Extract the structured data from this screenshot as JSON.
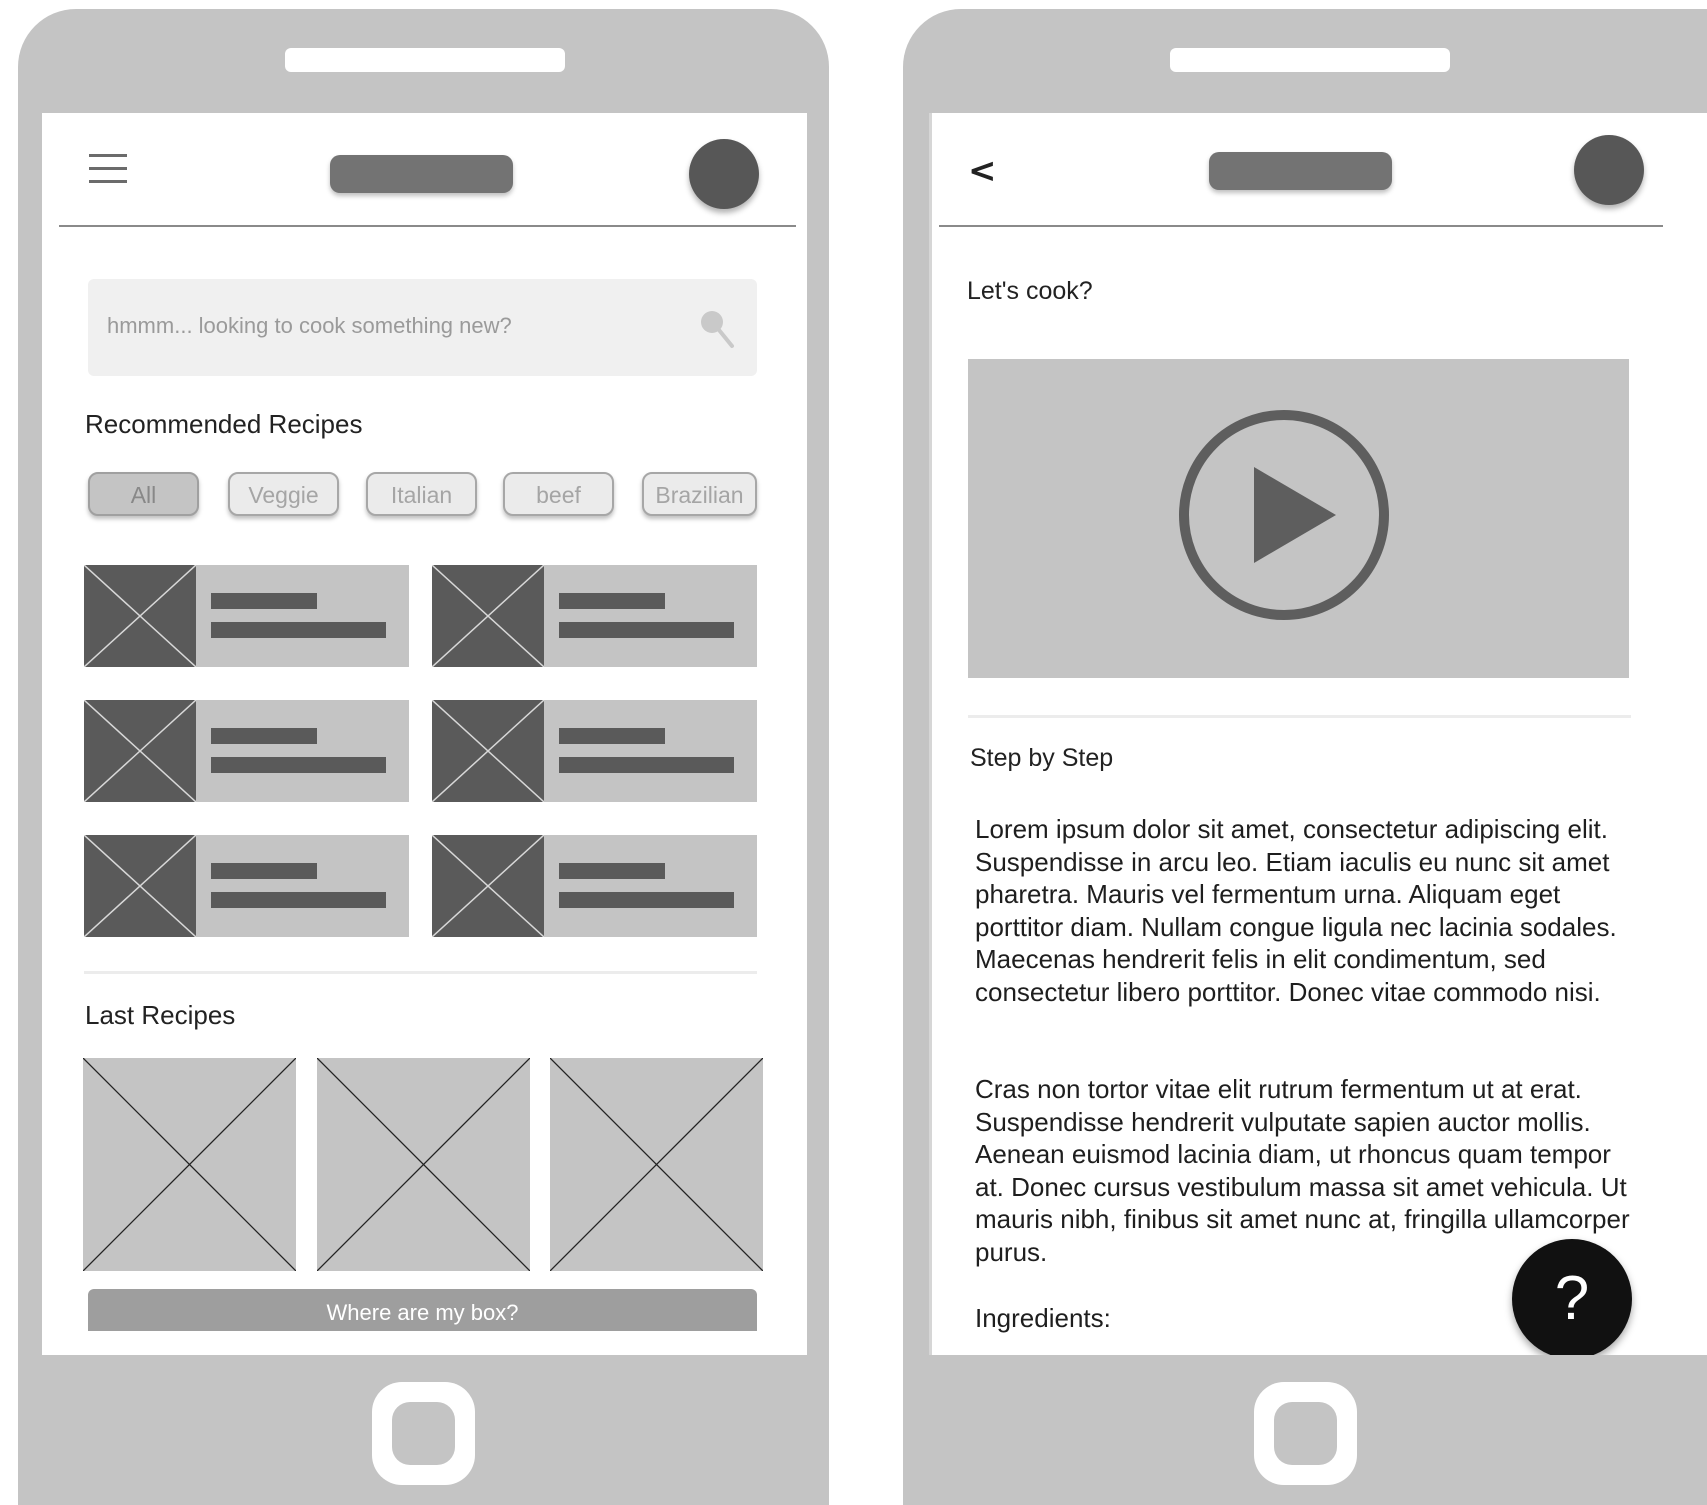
{
  "left_screen": {
    "search": {
      "placeholder": "hmmm... looking to cook something new?",
      "icon": "search-icon"
    },
    "recommended_title": "Recommended Recipes",
    "chips": [
      {
        "label": "All",
        "active": true
      },
      {
        "label": "Veggie",
        "active": false
      },
      {
        "label": "Italian",
        "active": false
      },
      {
        "label": "beef",
        "active": false
      },
      {
        "label": "Brazilian",
        "active": false
      }
    ],
    "last_recipes_title": "Last Recipes",
    "cta_label": "Where are my box?"
  },
  "right_screen": {
    "intro": "Let's cook?",
    "step_title": "Step by Step",
    "paragraphs": [
      "Lorem ipsum dolor sit amet, consectetur adipiscing elit. Suspendisse in arcu leo. Etiam iaculis eu nunc sit amet pharetra. Mauris vel fermentum urna. Aliquam eget porttitor diam. Nullam congue ligula nec lacinia sodales. Maecenas hendrerit felis in elit condimentum, sed consectetur libero porttitor. Donec vitae commodo nisi.",
      "Cras non tortor vitae elit rutrum fermentum ut at erat. Suspendisse hendrerit vulputate sapien auctor mollis. Aenean euismod lacinia diam, ut rhoncus quam tempor at. Donec cursus vestibulum massa sit amet vehicula. Ut mauris nibh, finibus sit amet nunc at, fringilla ullamcorper purus."
    ],
    "ingredients_label": "Ingredients:",
    "help_label": "?",
    "back_icon": "back-icon",
    "video_icon": "play-icon"
  },
  "colors": {
    "device": "#c4c4c4",
    "dark_fill": "#5a5a5a",
    "title_pill": "#737373",
    "cta": "#9e9e9e",
    "fab": "#111111"
  }
}
